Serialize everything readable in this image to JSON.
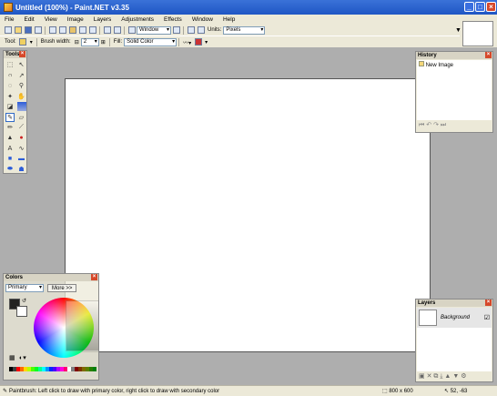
{
  "window": {
    "title": "Untitled (100%) - Paint.NET v3.35"
  },
  "menu": [
    "File",
    "Edit",
    "View",
    "Image",
    "Layers",
    "Adjustments",
    "Effects",
    "Window",
    "Help"
  ],
  "toolbar1": {
    "zoom_label": "Window",
    "units_label": "Units:",
    "units_value": "Pixels"
  },
  "toolbar2": {
    "tool_label": "Tool:",
    "brush_width_label": "Brush width:",
    "brush_width_value": "2",
    "fill_label": "Fill:",
    "fill_value": "Solid Color"
  },
  "tools_panel": {
    "title": "Tools"
  },
  "history_panel": {
    "title": "History",
    "items": [
      "New Image"
    ]
  },
  "layers_panel": {
    "title": "Layers",
    "items": [
      "Background"
    ]
  },
  "colors_panel": {
    "title": "Colors",
    "mode": "Primary",
    "more_button": "More >>"
  },
  "status": {
    "hint": "Paintbrush: Left click to draw with primary color, right click to draw with secondary color",
    "image_size": "800 x 600",
    "cursor_pos": "52, -63"
  },
  "colors": {
    "accent": "#316ac5",
    "title_bar": "#1f56c4",
    "canvas": "#ffffff",
    "workspace": "#aeaeae"
  }
}
